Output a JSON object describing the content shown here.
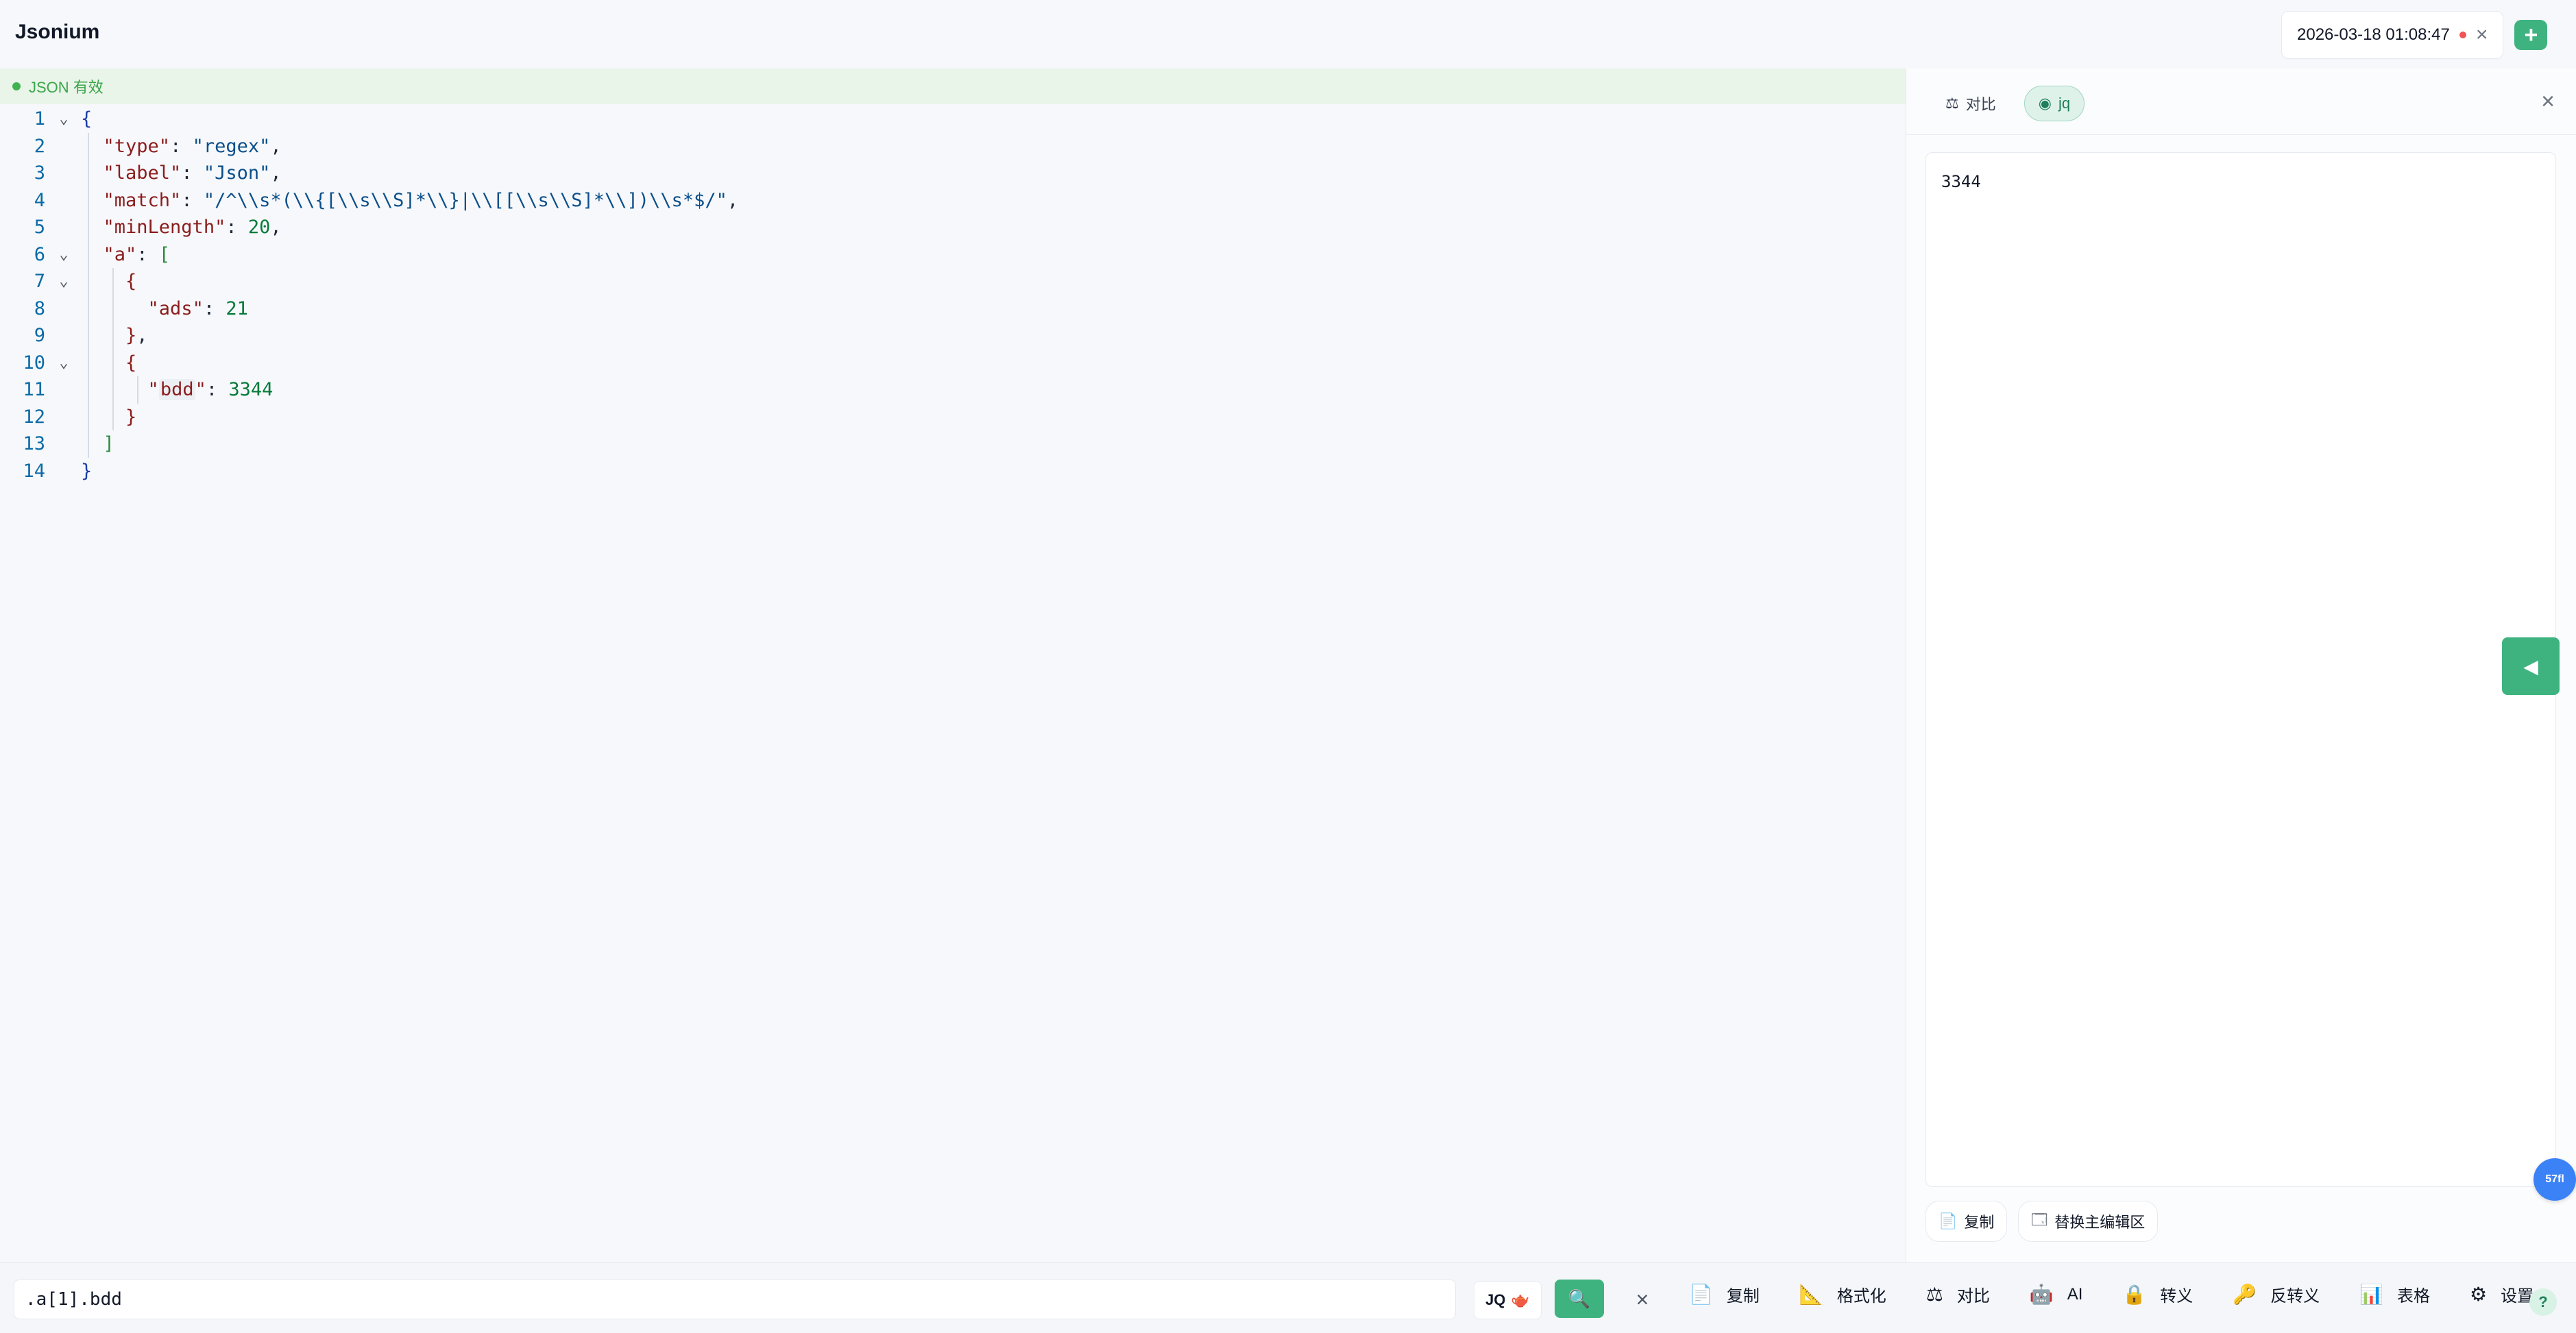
{
  "app": {
    "title": "Jsonium"
  },
  "tabs": [
    {
      "title": "2026-03-18 01:08:47",
      "has_dot": true,
      "close": "×"
    }
  ],
  "add_tab": {
    "label": "+"
  },
  "status": {
    "text": "JSON 有效"
  },
  "editor": {
    "lines": [
      {
        "n": "1"
      },
      {
        "n": "2"
      },
      {
        "n": "3"
      },
      {
        "n": "4"
      },
      {
        "n": "5"
      },
      {
        "n": "6"
      },
      {
        "n": "7"
      },
      {
        "n": "8"
      },
      {
        "n": "9"
      },
      {
        "n": "10"
      },
      {
        "n": "11"
      },
      {
        "n": "12"
      },
      {
        "n": "13"
      },
      {
        "n": "14"
      }
    ],
    "tokens": {
      "open_brace": "{",
      "close_brace": "}",
      "type_key": "\"type\"",
      "type_val": "\"regex\"",
      "label_key": "\"label\"",
      "label_val": "\"Json\"",
      "match_key": "\"match\"",
      "match_val": "\"/^\\\\s*(\\\\{[\\\\s\\\\S]*\\\\}|\\\\[[\\\\s\\\\S]*\\\\])\\\\s*$/\"",
      "minLength_key": "\"minLength\"",
      "minLength_val": "20",
      "a_key": "\"a\"",
      "open_bracket": "[",
      "close_bracket": "]",
      "ads_key": "\"ads\"",
      "ads_val": "21",
      "bdd_key_quote": "\"",
      "bdd_key_word": "bdd",
      "bdd_val": "3344",
      "comma": ",",
      "colon": ":"
    }
  },
  "right_panel": {
    "tabs": [
      {
        "label": "对比",
        "icon": "compare-icon",
        "active": false
      },
      {
        "label": "jq",
        "icon": "jq-icon",
        "active": true
      }
    ],
    "close": "×",
    "output": "3344",
    "actions": [
      {
        "label": "复制",
        "icon": "copy-icon"
      },
      {
        "label": "替换主编辑区",
        "icon": "replace-icon"
      }
    ]
  },
  "side_toggle": {
    "label": "◀"
  },
  "fps": {
    "label": "57fl"
  },
  "bottom": {
    "query_value": ".a[1].bdd",
    "jq_chip": {
      "label": "JQ",
      "icon": "jq-small-icon"
    },
    "run_icon": "search-icon",
    "clear": "×",
    "tools": [
      {
        "label": "复制",
        "icon": "copy-icon"
      },
      {
        "label": "格式化",
        "icon": "ruler-icon"
      },
      {
        "label": "对比",
        "icon": "compare-icon"
      },
      {
        "label": "AI",
        "icon": "robot-icon"
      },
      {
        "label": "转义",
        "icon": "lock-icon"
      },
      {
        "label": "反转义",
        "icon": "key-icon"
      },
      {
        "label": "表格",
        "icon": "chart-icon"
      },
      {
        "label": "设置",
        "icon": "gear-icon"
      }
    ],
    "help": "?"
  },
  "colors": {
    "accent": "#3fb37f",
    "status_bg": "#e9f5e8",
    "status_text": "#3aa54b",
    "fps_bubble": "#3b82f6",
    "line_number": "#0b6aa6"
  }
}
